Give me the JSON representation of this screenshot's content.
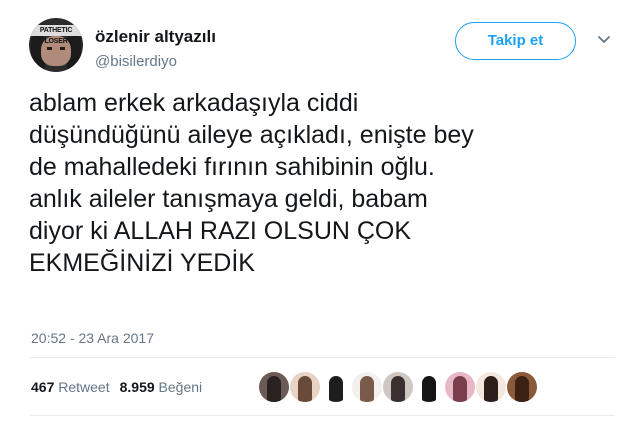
{
  "author": {
    "avatar_text": "PATHETIC LOSER",
    "display_name": "özlenir altyazılı",
    "handle": "@bisilerdiyo"
  },
  "follow_label": "Takip et",
  "tweet": {
    "text": "ablam erkek arkadaşıyla ciddi\ndüşündüğünü aileye açıkladı, enişte bey\nde mahalledeki fırının sahibinin oğlu.\nanlık aileler tanışmaya geldi, babam\ndiyor ki ALLAH RAZI OLSUN ÇOK\nEKMEĞİNİZİ YEDİK",
    "timestamp": "20:52 - 23 Ara 2017"
  },
  "stats": {
    "retweets_count": "467",
    "retweets_label": "Retweet",
    "likes_count": "8.959",
    "likes_label": "Beğeni"
  },
  "colors": {
    "accent": "#1da1f2",
    "muted": "#657786",
    "text": "#14171a"
  },
  "liker_avatars": [
    {
      "bg": "#6b5a55",
      "fg": "#2a2220"
    },
    {
      "bg": "#e9d3c4",
      "fg": "#6a4b3a"
    },
    {
      "bg": "#ffffff",
      "fg": "#1d1d1d"
    },
    {
      "bg": "#f3f0ee",
      "fg": "#7a5b4a"
    },
    {
      "bg": "#cfc7c2",
      "fg": "#3b3030"
    },
    {
      "bg": "#ffffff",
      "fg": "#151515"
    },
    {
      "bg": "#e8b7c6",
      "fg": "#7a3d4c"
    },
    {
      "bg": "#f6e7dc",
      "fg": "#2f1f1a"
    },
    {
      "bg": "#8b5a3a",
      "fg": "#3b2014"
    }
  ]
}
